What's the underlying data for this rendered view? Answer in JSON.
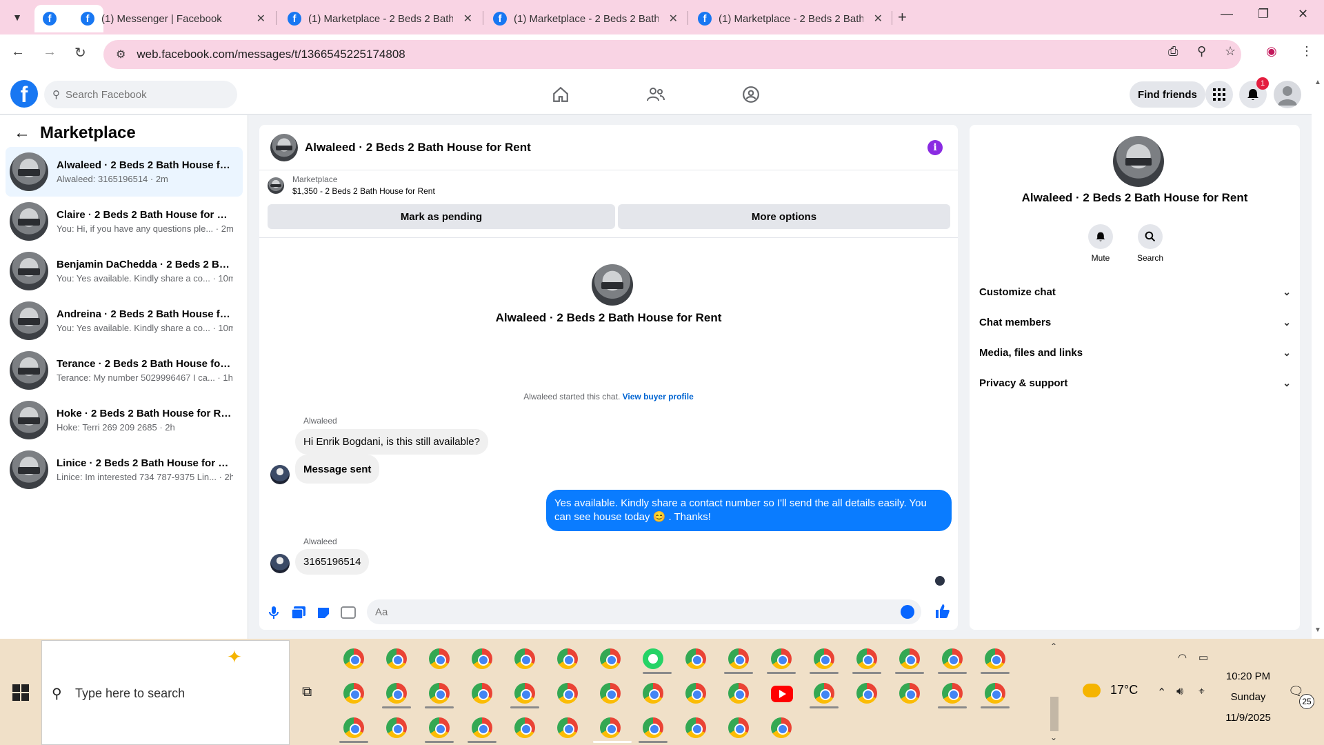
{
  "browser": {
    "tabs": [
      {
        "title": "(1) Messenger | Facebook",
        "active": true
      },
      {
        "title": "(1) Marketplace - 2 Beds 2 Bath",
        "active": false
      },
      {
        "title": "(1) Marketplace - 2 Beds 2 Bath",
        "active": false
      },
      {
        "title": "(1) Marketplace - 2 Beds 2 Bath",
        "active": false
      }
    ],
    "url": "web.facebook.com/messages/t/1366545225174808"
  },
  "header": {
    "search_placeholder": "Search Facebook",
    "find_friends": "Find friends",
    "notification_count": "1"
  },
  "sidebar": {
    "title": "Marketplace",
    "conversations": [
      {
        "name": "Alwaleed · 2 Beds 2 Bath House fo...",
        "snippet": "Alwaleed: 3165196514 · 2m"
      },
      {
        "name": "Claire · 2 Beds 2 Bath House for Re...",
        "snippet": "You: Hi, if you have any questions ple... · 2m"
      },
      {
        "name": "Benjamin DaChedda · 2 Beds 2 Bat...",
        "snippet": "You: Yes available. Kindly share a co... · 10m"
      },
      {
        "name": "Andreina · 2 Beds 2 Bath House fo...",
        "snippet": "You: Yes available. Kindly share a co... · 10m"
      },
      {
        "name": "Terance · 2 Beds 2 Bath House for ...",
        "snippet": "Terance: My number 5029996467 I ca... · 1h"
      },
      {
        "name": "Hoke · 2 Beds 2 Bath House for Rent",
        "snippet": "Hoke: Terri 269 209 2685 · 2h"
      },
      {
        "name": "Linice · 2 Beds 2 Bath House for Re...",
        "snippet": "Linice: Im interested 734 787-9375 Lin... · 2h"
      }
    ]
  },
  "chat": {
    "title": "Alwaleed · 2 Beds 2 Bath House for Rent",
    "marketplace_label": "Marketplace",
    "listing": "$1,350 - 2 Beds 2 Bath House for Rent",
    "mark_pending": "Mark as pending",
    "more_options": "More options",
    "intro_title": "Alwaleed · 2 Beds 2 Bath House for Rent",
    "started_text": "Alwaleed started this chat.",
    "view_buyer_profile": "View buyer profile",
    "messages": [
      {
        "sender": "Alwaleed",
        "text": "Hi Enrik Bogdani, is this still available?"
      },
      {
        "sender": "",
        "text": "Message sent"
      },
      {
        "sender": "",
        "text": "Yes available. Kindly share a contact number so I'll send the all details easily. You can see house today 😊 . Thanks!"
      },
      {
        "sender": "Alwaleed",
        "text": "3165196514"
      }
    ],
    "composer_placeholder": "Aa"
  },
  "details": {
    "title": "Alwaleed · 2 Beds 2 Bath House for Rent",
    "mute": "Mute",
    "search": "Search",
    "sections": [
      "Customize chat",
      "Chat members",
      "Media, files and links",
      "Privacy & support"
    ]
  },
  "taskbar": {
    "search_placeholder": "Type here to search",
    "temperature": "17°C",
    "time": "10:20 PM",
    "day": "Sunday",
    "date": "11/9/2025",
    "notification_count": "25"
  }
}
